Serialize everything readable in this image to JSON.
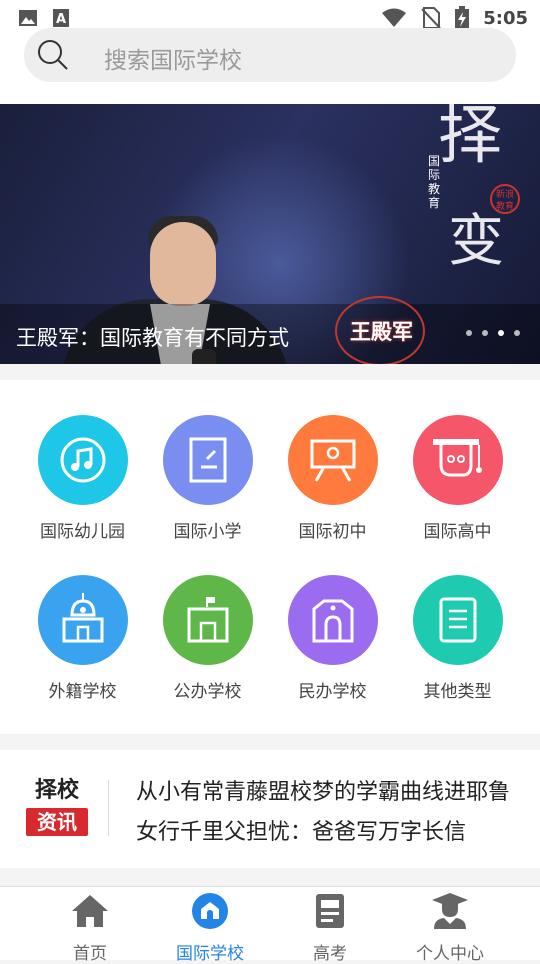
{
  "status_bar": {
    "time": "5:05"
  },
  "search": {
    "placeholder": "搜索国际学校"
  },
  "banner": {
    "caption": "王殿军：国际教育有不同方式",
    "name_badge": "王殿军",
    "calligraphy_big": "择",
    "calligraphy_big2": "变",
    "calligraphy_small": "国际教育",
    "seal": "新浪教育",
    "slides": 4,
    "active_slide": 3
  },
  "categories": [
    {
      "label": "国际幼儿园",
      "icon": "music-note-icon",
      "color": "#1ec6e8"
    },
    {
      "label": "国际小学",
      "icon": "notebook-icon",
      "color": "#7a8df0"
    },
    {
      "label": "国际初中",
      "icon": "presentation-board-icon",
      "color": "#ff7a3d"
    },
    {
      "label": "国际高中",
      "icon": "graduation-cap-icon",
      "color": "#f5566a"
    },
    {
      "label": "外籍学校",
      "icon": "mosque-building-icon",
      "color": "#3aa3f0"
    },
    {
      "label": "公办学校",
      "icon": "flag-building-icon",
      "color": "#5fb74a"
    },
    {
      "label": "民办学校",
      "icon": "arch-building-icon",
      "color": "#9b6cf0"
    },
    {
      "label": "其他类型",
      "icon": "document-list-icon",
      "color": "#1fcbb0"
    }
  ],
  "news": {
    "logo_top": "择校",
    "logo_bottom": "资讯",
    "items": [
      "从小有常青藤盟校梦的学霸曲线进耶鲁",
      "女行千里父担忧：爸爸写万字长信"
    ]
  },
  "tabs": [
    {
      "label": "首页",
      "icon": "home-icon",
      "active": false
    },
    {
      "label": "国际学校",
      "icon": "school-circle-icon",
      "active": true
    },
    {
      "label": "高考",
      "icon": "exam-paper-icon",
      "active": false
    },
    {
      "label": "个人中心",
      "icon": "user-graduate-icon",
      "active": false
    }
  ],
  "colors": {
    "accent": "#2384e8",
    "news_red": "#d8292e",
    "tab_inactive": "#666666"
  }
}
